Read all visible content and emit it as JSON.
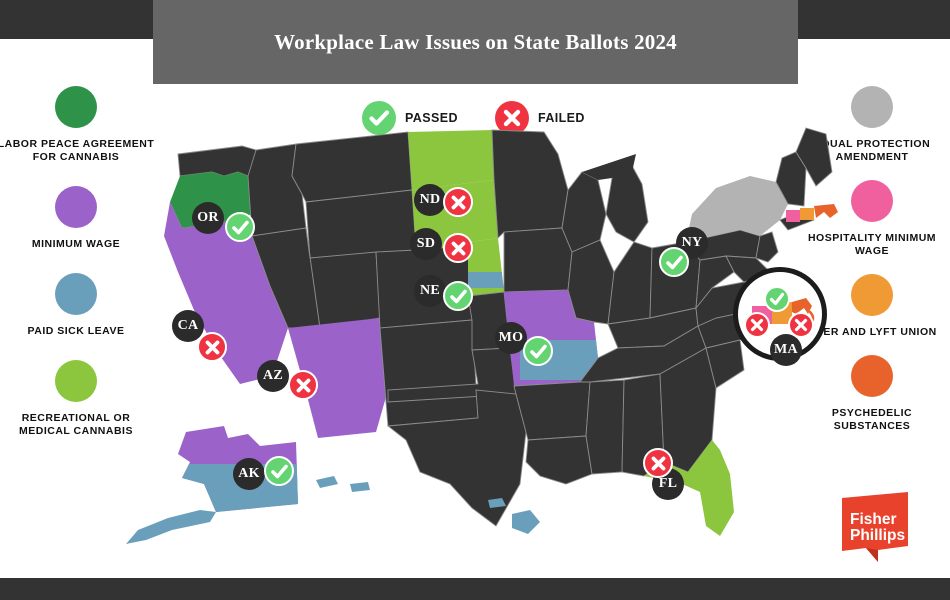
{
  "header": {
    "title": "Workplace Law Issues on State Ballots 2024"
  },
  "key": {
    "passed": {
      "label": "PASSED",
      "icon": "check-circle-icon",
      "color": "#63d471"
    },
    "failed": {
      "label": "FAILED",
      "icon": "x-circle-icon",
      "color": "#ef3340"
    }
  },
  "legend_left": [
    {
      "label": "LABOR PEACE AGREEMENT FOR CANNABIS",
      "color": "#2e9348",
      "key": "labor-peace-agreement-for-cannabis"
    },
    {
      "label": "MINIMUM WAGE",
      "color": "#9b62c9",
      "key": "minimum-wage"
    },
    {
      "label": "PAID SICK LEAVE",
      "color": "#6a9fbb",
      "key": "paid-sick-leave"
    },
    {
      "label": "RECREATIONAL OR MEDICAL CANNABIS",
      "color": "#8cc63e",
      "key": "recreational-or-medical-cannabis"
    }
  ],
  "legend_right": [
    {
      "label": "EQUAL PROTECTION AMENDMENT",
      "color": "#b3b3b3",
      "key": "equal-protection-amendment"
    },
    {
      "label": "HOSPITALITY MINIMUM WAGE",
      "color": "#f0609f",
      "key": "hospitality-minimum-wage"
    },
    {
      "label": "UBER AND LYFT UNION",
      "color": "#ef9a34",
      "key": "uber-and-lyft-union"
    },
    {
      "label": "PSYCHEDELIC SUBSTANCES",
      "color": "#e8622c",
      "key": "psychedelic-substances"
    }
  ],
  "logo": {
    "line1": "Fisher",
    "line2": "Phillips",
    "color": "#e8412c"
  },
  "map": {
    "default_state_color": "#333333",
    "border_color": "#8c8c8c",
    "states": [
      {
        "abbr": "OR",
        "result": "PASSED",
        "issue": "LABOR PEACE AGREEMENT FOR CANNABIS",
        "color": "#2e9348"
      },
      {
        "abbr": "CA",
        "result": "FAILED",
        "issue": "MINIMUM WAGE",
        "color": "#9b62c9"
      },
      {
        "abbr": "AZ",
        "result": "FAILED",
        "issue": "MINIMUM WAGE",
        "color": "#9b62c9"
      },
      {
        "abbr": "ND",
        "result": "FAILED",
        "issue": "RECREATIONAL OR MEDICAL CANNABIS",
        "color": "#8cc63e"
      },
      {
        "abbr": "SD",
        "result": "FAILED",
        "issue": "RECREATIONAL OR MEDICAL CANNABIS",
        "color": "#8cc63e"
      },
      {
        "abbr": "NE",
        "result": "PASSED",
        "issue": "RECREATIONAL OR MEDICAL CANNABIS; PAID SICK LEAVE",
        "color": "#8cc63e"
      },
      {
        "abbr": "MO",
        "result": "PASSED",
        "issue": "MINIMUM WAGE; PAID SICK LEAVE",
        "color": "#9b62c9"
      },
      {
        "abbr": "NY",
        "result": "PASSED",
        "issue": "EQUAL PROTECTION AMENDMENT",
        "color": "#b3b3b3"
      },
      {
        "abbr": "AK",
        "result": "PASSED",
        "issue": "MINIMUM WAGE; PAID SICK LEAVE",
        "color": "#9b62c9"
      },
      {
        "abbr": "FL",
        "result": "FAILED",
        "issue": "RECREATIONAL OR MEDICAL CANNABIS",
        "color": "#8cc63e"
      },
      {
        "abbr": "MA",
        "result": "MIXED",
        "issue": "HOSPITALITY MINIMUM WAGE; UBER AND LYFT UNION; PSYCHEDELIC SUBSTANCES",
        "color": "#ef9a34"
      }
    ],
    "inset": {
      "abbr": "MA",
      "items": [
        {
          "issue": "HOSPITALITY MINIMUM WAGE",
          "color": "#f0609f",
          "result": "FAILED"
        },
        {
          "issue": "UBER AND LYFT UNION",
          "color": "#ef9a34",
          "result": "PASSED"
        },
        {
          "issue": "PSYCHEDELIC SUBSTANCES",
          "color": "#e8622c",
          "result": "FAILED"
        }
      ]
    }
  }
}
